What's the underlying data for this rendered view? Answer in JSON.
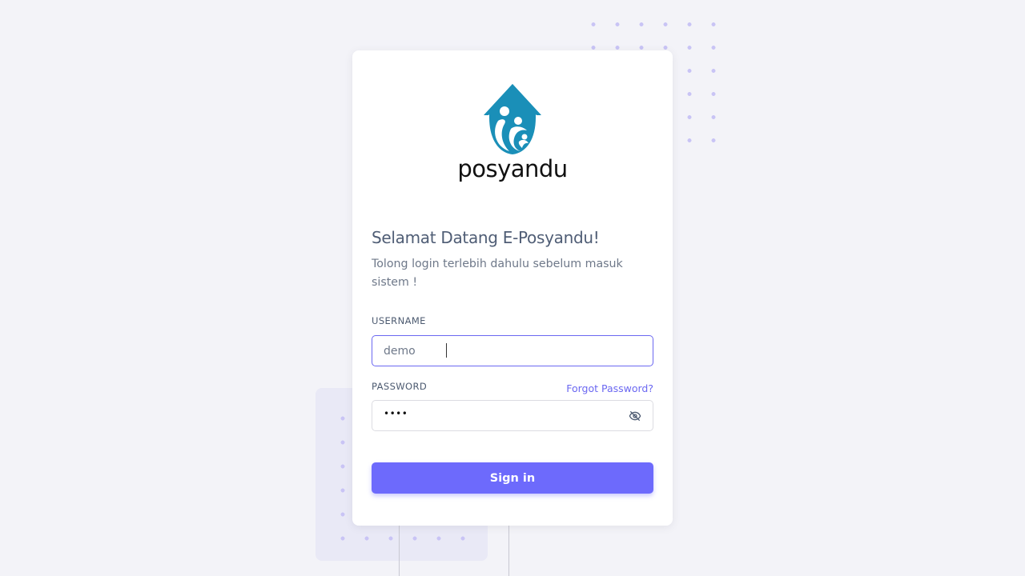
{
  "brand": {
    "logo_text": "posyandu",
    "logo_color": "#1a8fb8"
  },
  "login": {
    "title": "Selamat Datang E-Posyandu!",
    "subtitle": "Tolong login terlebih dahulu sebelum masuk sistem !",
    "username_label": "USERNAME",
    "username_value": "demo",
    "password_label": "PASSWORD",
    "password_masked": "••••",
    "forgot_password": "Forgot Password?",
    "toggle_icon": "eye-off-icon",
    "sign_in": "Sign in"
  },
  "colors": {
    "accent": "#6d6afc",
    "background": "#f3f3f8"
  }
}
